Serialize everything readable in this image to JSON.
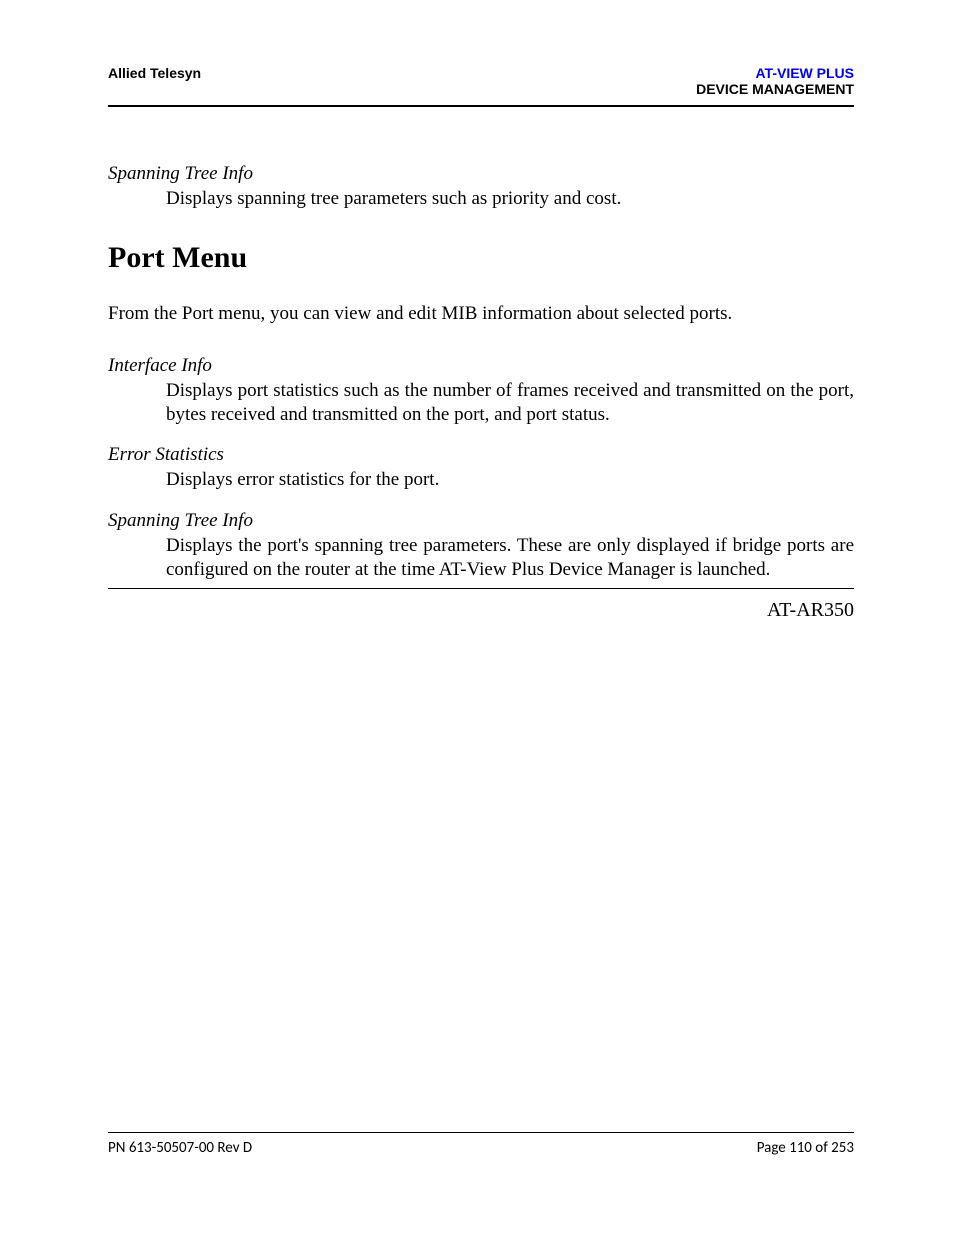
{
  "header": {
    "left": "Allied Telesyn",
    "right_line1": "AT-VIEW PLUS",
    "right_line2": "DEVICE MANAGEMENT"
  },
  "sections": {
    "spanning_tree_top": {
      "term": "Spanning Tree Info",
      "desc": "Displays spanning tree parameters such as priority and cost."
    },
    "port_menu_heading": "Port Menu",
    "port_menu_intro": "From the Port menu, you can view and edit MIB information about selected ports.",
    "interface_info": {
      "term": "Interface Info",
      "desc": "Displays port statistics such as the number of frames received and transmitted on the port, bytes received and transmitted on the port, and port status."
    },
    "error_statistics": {
      "term": "Error Statistics",
      "desc": "Displays error statistics for the port."
    },
    "spanning_tree_bottom": {
      "term": "Spanning Tree Info",
      "desc": "Displays the port's spanning tree parameters. These are only displayed if bridge ports are configured on the router at the time AT-View Plus Device Manager is launched."
    }
  },
  "model_label": "AT-AR350",
  "footer": {
    "left": "PN 613-50507-00 Rev D",
    "right": "Page 110 of 253"
  }
}
